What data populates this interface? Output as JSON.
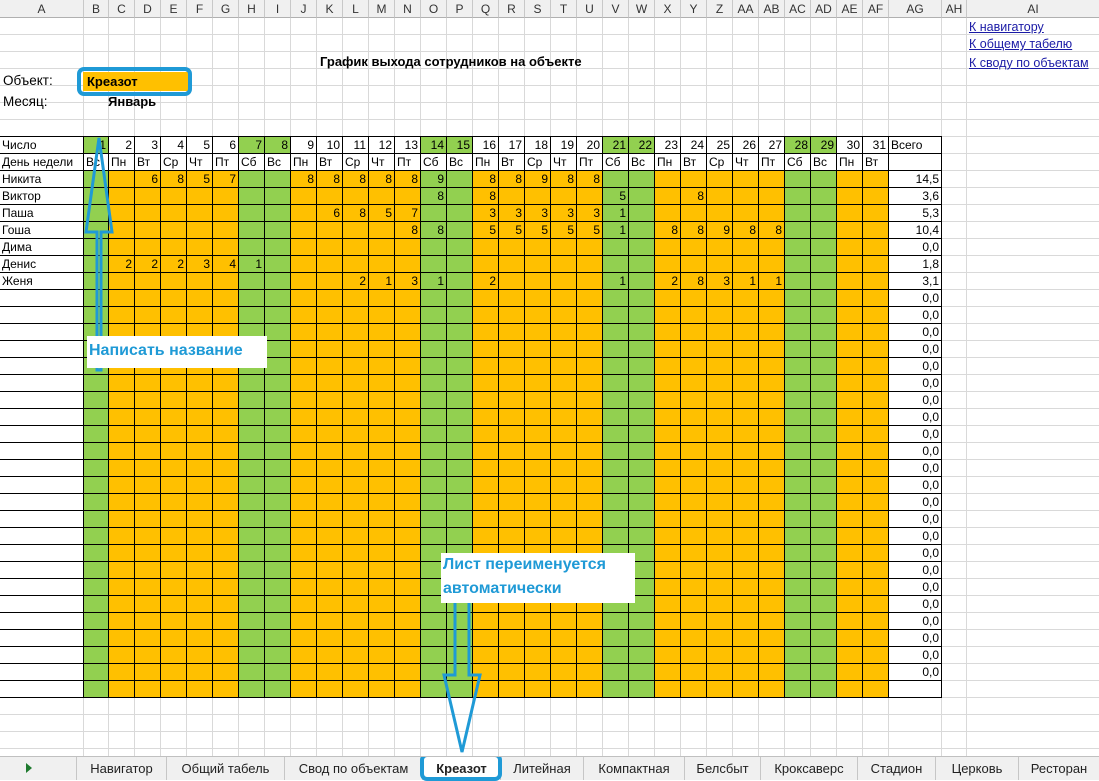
{
  "columns": [
    "A",
    "B",
    "C",
    "D",
    "E",
    "F",
    "G",
    "H",
    "I",
    "J",
    "K",
    "L",
    "M",
    "N",
    "O",
    "P",
    "Q",
    "R",
    "S",
    "T",
    "U",
    "V",
    "W",
    "X",
    "Y",
    "Z",
    "AA",
    "AB",
    "AC",
    "AD",
    "AE",
    "AF",
    "AG",
    "AH",
    "AI"
  ],
  "title": "График выхода сотрудников на объекте",
  "object_label": "Объект:",
  "object_value": "Креазот",
  "month_label": "Месяц:",
  "month_value": "Январь",
  "links": [
    "К навигатору",
    "К общему табелю",
    "К своду по объектам"
  ],
  "header_number_label": "Число",
  "header_weekday_label": "День недели",
  "total_label": "Всего",
  "days": [
    "1",
    "2",
    "3",
    "4",
    "5",
    "6",
    "7",
    "8",
    "9",
    "10",
    "11",
    "12",
    "13",
    "14",
    "15",
    "16",
    "17",
    "18",
    "19",
    "20",
    "21",
    "22",
    "23",
    "24",
    "25",
    "26",
    "27",
    "28",
    "29",
    "30",
    "31"
  ],
  "weekdays": [
    "Вс",
    "Пн",
    "Вт",
    "Ср",
    "Чт",
    "Пт",
    "Сб",
    "Вс",
    "Пн",
    "Вт",
    "Ср",
    "Чт",
    "Пт",
    "Сб",
    "Вс",
    "Пн",
    "Вт",
    "Ср",
    "Чт",
    "Пт",
    "Сб",
    "Вс",
    "Пн",
    "Вт",
    "Ср",
    "Чт",
    "Пт",
    "Сб",
    "Вс",
    "Пн",
    "Вт"
  ],
  "weekend_days": [
    1,
    7,
    8,
    14,
    15,
    21,
    22,
    28,
    29
  ],
  "employees": [
    {
      "name": "Никита",
      "hours": {
        "3": "6",
        "4": "8",
        "5": "5",
        "6": "7",
        "9": "8",
        "10": "8",
        "11": "8",
        "12": "8",
        "13": "8",
        "14": "9",
        "16": "8",
        "17": "8",
        "18": "9",
        "19": "8",
        "20": "8"
      },
      "total": "14,5"
    },
    {
      "name": "Виктор",
      "hours": {
        "14": "8",
        "16": "8",
        "21": "5",
        "24": "8"
      },
      "total": "3,6"
    },
    {
      "name": "Паша",
      "hours": {
        "10": "6",
        "11": "8",
        "12": "5",
        "13": "7",
        "16": "3",
        "17": "3",
        "18": "3",
        "19": "3",
        "20": "3",
        "21": "1"
      },
      "total": "5,3"
    },
    {
      "name": "Гоша",
      "hours": {
        "13": "8",
        "14": "8",
        "16": "5",
        "17": "5",
        "18": "5",
        "19": "5",
        "20": "5",
        "21": "1",
        "23": "8",
        "24": "8",
        "25": "9",
        "26": "8",
        "27": "8"
      },
      "total": "10,4"
    },
    {
      "name": "Дима",
      "hours": {},
      "total": "0,0"
    },
    {
      "name": "Денис",
      "hours": {
        "2": "2",
        "3": "2",
        "4": "2",
        "5": "3",
        "6": "4",
        "7": "1"
      },
      "total": "1,8"
    },
    {
      "name": "Женя",
      "hours": {
        "11": "2",
        "12": "1",
        "13": "3",
        "14": "1",
        "16": "2",
        "21": "1",
        "23": "2",
        "24": "8",
        "25": "3",
        "26": "1",
        "27": "1"
      },
      "total": "3,1"
    }
  ],
  "empty_row_total": "0,0",
  "empty_rows": 23,
  "callouts": {
    "name_hint": "Написать название",
    "rename_hint_line1": "Лист переименуется",
    "rename_hint_line2": "автоматически"
  },
  "sheet_tabs": [
    "Навигатор",
    "Общий табель",
    "Свод по объектам",
    "Креазот",
    "Литейная",
    "Компактная",
    "Белсбыт",
    "Кроксаверс",
    "Стадион",
    "Церковь",
    "Ресторан"
  ],
  "active_tab": "Креазот",
  "colors": {
    "workday": "#ffc000",
    "weekend": "#92d050",
    "object_fill": "#ffc000",
    "annotation": "#1f9ad6",
    "link": "#1a1aa6",
    "header_bg": "#f0f0f0"
  }
}
